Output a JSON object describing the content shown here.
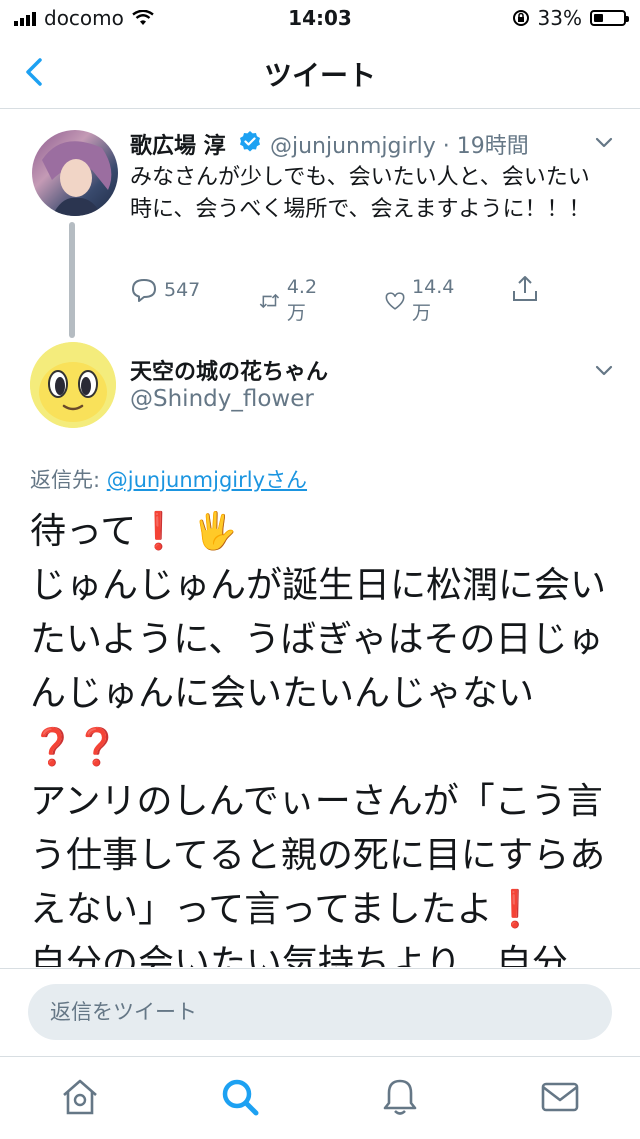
{
  "status_bar": {
    "carrier": "docomo",
    "time": "14:03",
    "battery_percent": "33%",
    "battery_level": 0.33
  },
  "header": {
    "title": "ツイート"
  },
  "tweet1": {
    "name": "歌広場 淳",
    "handle_time": "@junjunmjgirly · 19時間",
    "text": "みなさんが少しでも、会いたい人と、会いたい時に、会うべく場所で、会えますように！！！",
    "replies": "547",
    "retweets": "4.2万",
    "likes": "14.4万"
  },
  "tweet2": {
    "name": "天空の城の花ちゃん",
    "handle": "@Shindy_flower",
    "reply_to_label": "返信先: ",
    "reply_to_user": "@junjunmjgirlyさん",
    "lines": [
      "待って",
      "じゅんじゅんが誕生日に松潤に会いたいように、うばぎゃはその日じゅんじゅんに会いたいんじゃない",
      "アンリのしんでぃーさんが「こう言う仕事してると親の死に目にすらあえない」って言ってましたよ",
      "自分の会いたい気持ちより、自分"
    ],
    "emoji": {
      "exclamation": "❗",
      "hand": "🖐",
      "question": "❓"
    }
  },
  "reply_bar": {
    "placeholder": "返信をツイート"
  },
  "tabs": [
    "home",
    "search",
    "notifications",
    "messages"
  ],
  "colors": {
    "accent": "#1da1f2",
    "text": "#14171a",
    "muted": "#657786",
    "red": "#e0245e"
  }
}
